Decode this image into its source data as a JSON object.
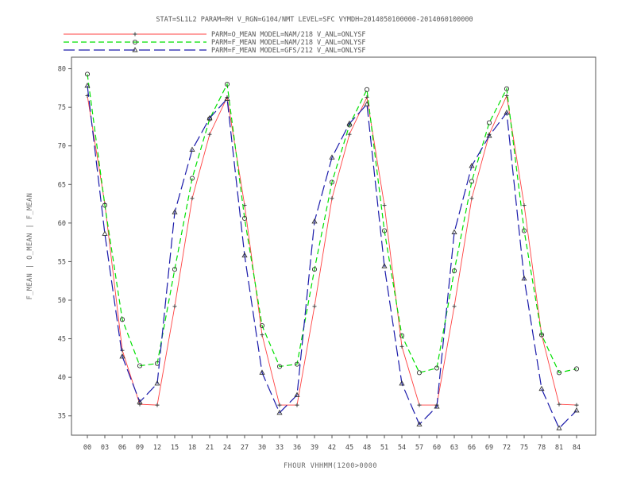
{
  "chart_data": {
    "type": "line",
    "title": "STAT=SL1L2 PARAM=RH V_RGN=G104/NMT LEVEL=SFC VYMDH=2014050100000-2014060100000",
    "xlabel": "FHOUR VHHMM(1200>0000",
    "ylabel": "F_MEAN | O_MEAN | F_MEAN",
    "categories": [
      "00",
      "03",
      "06",
      "09",
      "12",
      "15",
      "18",
      "21",
      "24",
      "27",
      "30",
      "33",
      "36",
      "39",
      "42",
      "45",
      "48",
      "51",
      "54",
      "57",
      "60",
      "63",
      "66",
      "69",
      "72",
      "75",
      "78",
      "81",
      "84"
    ],
    "ylim": [
      32.5,
      81.5
    ],
    "yticks": [
      35,
      40,
      45,
      50,
      55,
      60,
      65,
      70,
      75,
      80
    ],
    "legend_position": "top-left",
    "series": [
      {
        "name": "PARM=O_MEAN MODEL=NAM/218 V_ANL=ONLYSF",
        "color": "#ff4040",
        "dash": "solid",
        "marker": "plus",
        "values": [
          76.5,
          62.5,
          43.5,
          36.5,
          36.4,
          49.2,
          63.2,
          71.5,
          76.3,
          62.3,
          45.5,
          36.4,
          36.4,
          49.2,
          63.2,
          71.5,
          76.3,
          62.3,
          44.0,
          36.4,
          36.4,
          49.2,
          63.2,
          71.5,
          76.5,
          62.3,
          45.5,
          36.5,
          36.4
        ]
      },
      {
        "name": "PARM=F_MEAN MODEL=NAM/218 V_ANL=ONLYSF",
        "color": "#00e000",
        "dash": "dashed",
        "marker": "circle",
        "values": [
          79.3,
          62.3,
          47.5,
          41.5,
          41.8,
          54.0,
          65.8,
          73.5,
          78.0,
          60.6,
          46.7,
          41.4,
          41.7,
          54.0,
          65.3,
          72.7,
          77.3,
          59.0,
          45.4,
          40.6,
          41.2,
          53.8,
          65.4,
          73.0,
          77.4,
          59.0,
          45.5,
          40.6,
          41.1
        ]
      },
      {
        "name": "PARM=F_MEAN MODEL=GFS/212 V_ANL=ONLYSF",
        "color": "#1a1aaa",
        "dash": "longdash",
        "marker": "triangle",
        "values": [
          77.8,
          58.6,
          42.7,
          36.8,
          39.2,
          61.4,
          69.5,
          73.6,
          76.1,
          55.8,
          40.6,
          35.4,
          37.7,
          60.2,
          68.5,
          72.9,
          75.4,
          54.4,
          39.2,
          33.9,
          36.2,
          58.8,
          67.4,
          71.3,
          74.3,
          52.8,
          38.5,
          33.4,
          35.7
        ]
      }
    ]
  }
}
